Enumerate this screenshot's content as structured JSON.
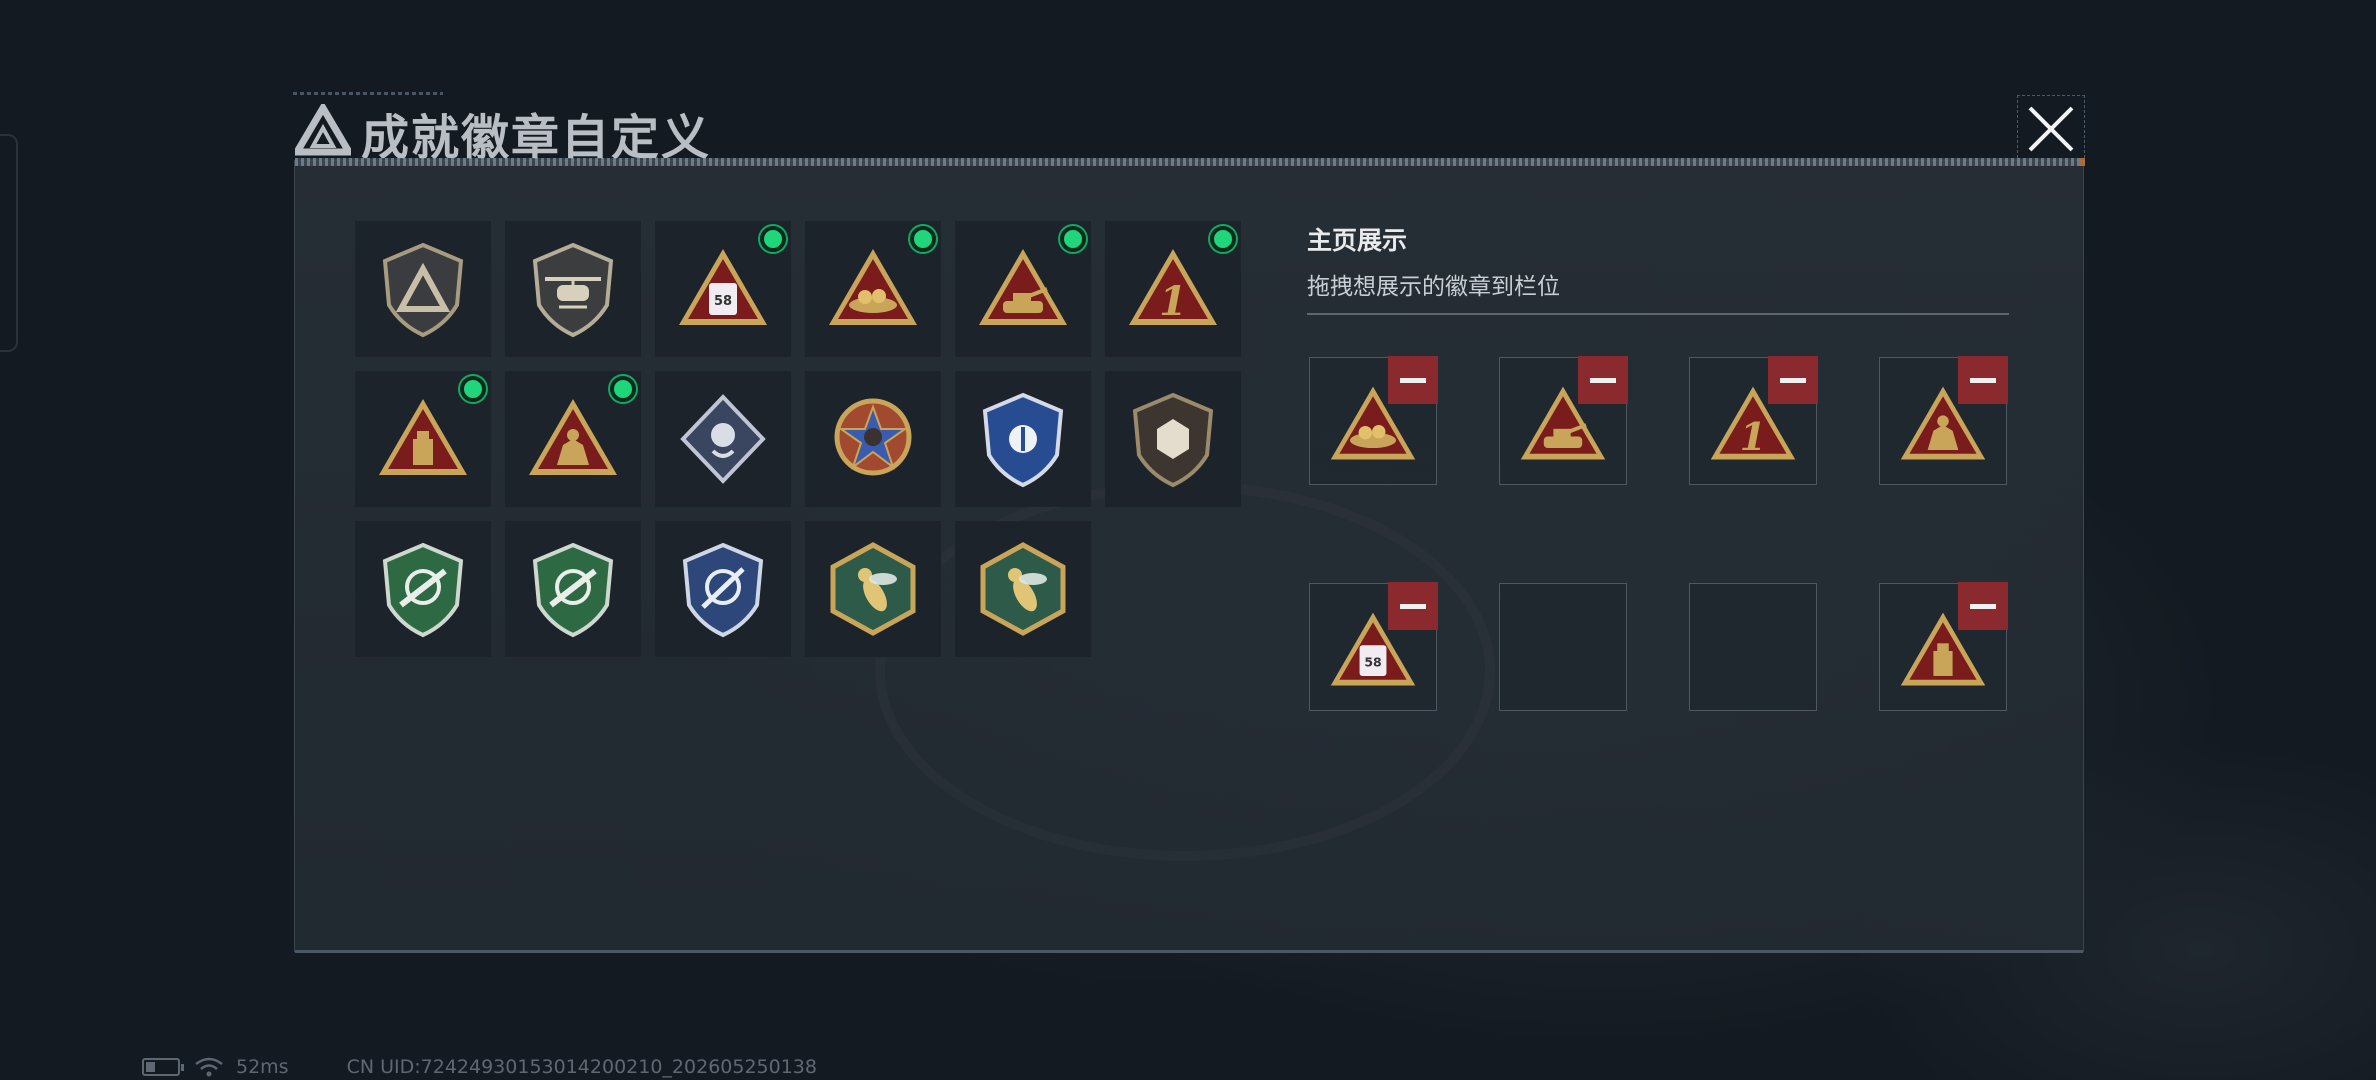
{
  "dialog": {
    "title": "成就徽章自定义",
    "close_icon": "close-icon"
  },
  "badges": [
    {
      "icon": "triangle-logo-shield-badge",
      "new": false
    },
    {
      "icon": "helicopter-shield-badge",
      "new": false
    },
    {
      "icon": "bus-58-triangle-badge",
      "new": true,
      "label": "58"
    },
    {
      "icon": "nest-eggs-triangle-badge",
      "new": true
    },
    {
      "icon": "tank-triangle-badge",
      "new": true
    },
    {
      "icon": "number-one-triangle-badge",
      "new": true,
      "label": "1"
    },
    {
      "icon": "usb-drive-triangle-badge",
      "new": true
    },
    {
      "icon": "mech-soldier-triangle-badge",
      "new": true
    },
    {
      "icon": "rose-diamond-badge",
      "new": false
    },
    {
      "icon": "star-medal-badge",
      "new": false
    },
    {
      "icon": "blue-shield-badge",
      "new": false
    },
    {
      "icon": "dice-shield-badge",
      "new": false
    },
    {
      "icon": "green-rifle-crosshair-badge",
      "new": false
    },
    {
      "icon": "green-rifle-crosshair-star-badge",
      "new": false
    },
    {
      "icon": "blue-knife-crosshair-badge",
      "new": false
    },
    {
      "icon": "wasp-hexagon-badge",
      "new": false
    },
    {
      "icon": "wasp-hexagon-badge-2",
      "new": false
    }
  ],
  "showcase": {
    "title": "主页展示",
    "subtitle": "拖拽想展示的徽章到栏位",
    "slots": [
      {
        "icon": "nest-eggs-triangle-badge",
        "filled": true
      },
      {
        "icon": "tank-triangle-badge",
        "filled": true
      },
      {
        "icon": "number-one-triangle-badge",
        "filled": true,
        "label": "1"
      },
      {
        "icon": "mech-soldier-triangle-badge",
        "filled": true
      },
      {
        "icon": "bus-58-triangle-badge",
        "filled": true,
        "label": "58"
      },
      {
        "icon": "",
        "filled": false
      },
      {
        "icon": "",
        "filled": false
      },
      {
        "icon": "usb-drive-triangle-badge",
        "filled": true
      }
    ]
  },
  "status_bar": {
    "ping": "52ms",
    "uid": "CN UID:7242493015301420021​0_202605250138"
  },
  "colors": {
    "accent_green": "#1fd67a",
    "remove_red": "#8a2a2e",
    "gold": "#c9a55a",
    "badge_red": "#7a1c1c"
  }
}
